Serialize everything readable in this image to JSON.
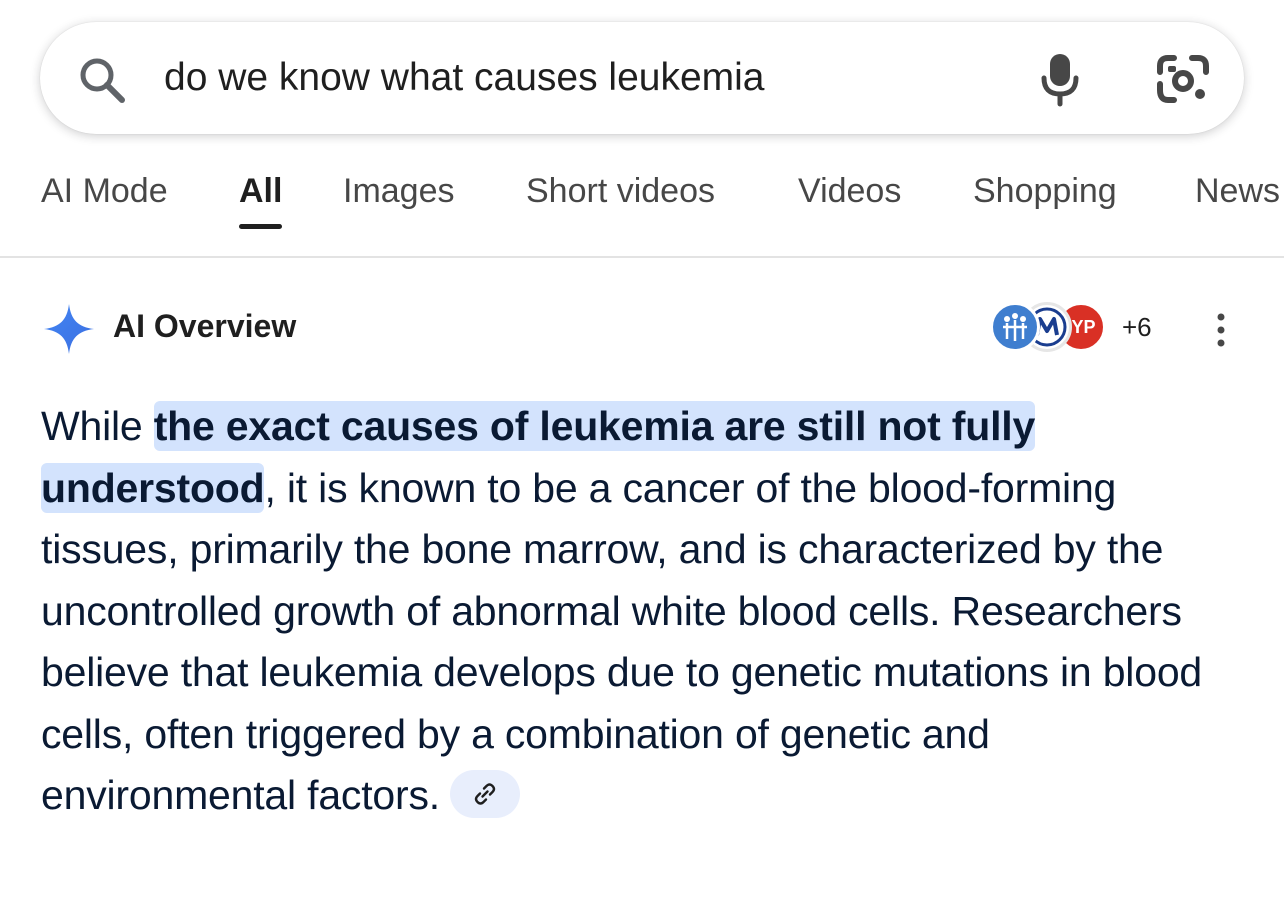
{
  "search": {
    "query": "do we know what causes leukemia"
  },
  "tabs": [
    {
      "label": "AI Mode"
    },
    {
      "label": "All",
      "active": true
    },
    {
      "label": "Images"
    },
    {
      "label": "Short videos"
    },
    {
      "label": "Videos"
    },
    {
      "label": "Shopping"
    },
    {
      "label": "News"
    }
  ],
  "ai_overview": {
    "title": "AI Overview",
    "source_count": "+6",
    "sources": [
      {
        "icon": "medical-figures-logo"
      },
      {
        "icon": "m-logo"
      },
      {
        "label": "IYP"
      }
    ],
    "body_intro": "While ",
    "body_highlight": "the exact causes of leukemia are still not fully understood",
    "body_rest": ", it is known to be a cancer of the blood-forming tissues, primarily the bone marrow, and is characterized by the uncontrolled growth of abnormal white blood cells. Researchers believe that leukemia develops due to genetic mutations in blood cells, often triggered by a combination of genetic and environmental factors.",
    "link_icon": "link-icon"
  },
  "colors": {
    "highlight": "#d3e3fd",
    "accent_blue": "#4285f4",
    "text": "#0a1a33"
  }
}
